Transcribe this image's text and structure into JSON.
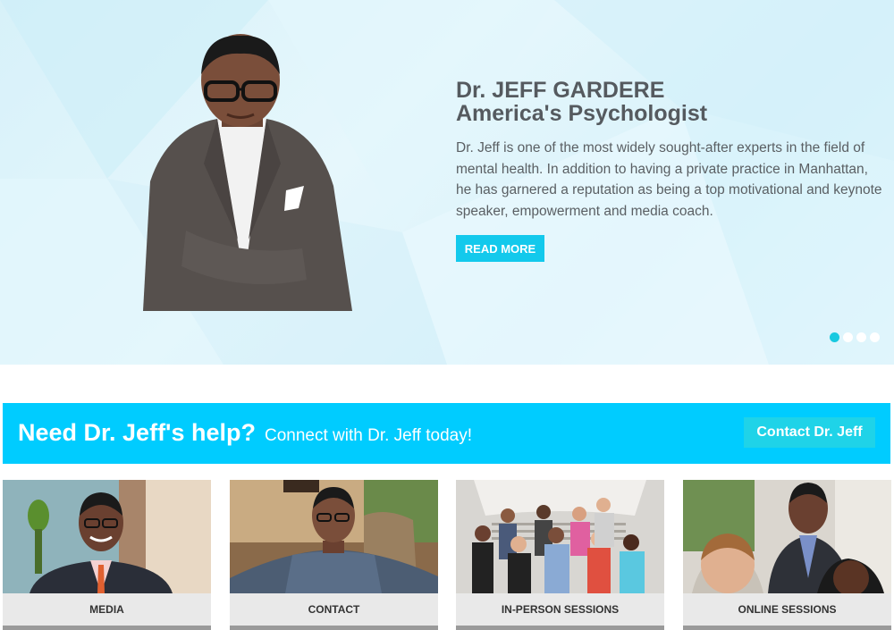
{
  "hero": {
    "title_line1": "Dr. JEFF GARDERE",
    "title_line2": "America's Psychologist",
    "text": "Dr. Jeff is one of the most widely sought-after experts in the field of mental health. In addition to having a private practice in Manhattan, he has garnered a reputation as being a top motivational and keynote speaker, empowerment and media coach.",
    "read_more": "READ MORE",
    "slides": 4,
    "active_slide": 1
  },
  "cta": {
    "strong": "Need Dr. Jeff's help?",
    "light": "Connect with Dr. Jeff today!",
    "button": "Contact Dr. Jeff"
  },
  "cards": [
    {
      "label": "MEDIA"
    },
    {
      "label": "CONTACT"
    },
    {
      "label": "IN-PERSON SESSIONS"
    },
    {
      "label": "ONLINE SESSIONS"
    }
  ],
  "colors": {
    "accent": "#00ccff",
    "button": "#13c9ec",
    "dot_active": "#18c9e0"
  }
}
